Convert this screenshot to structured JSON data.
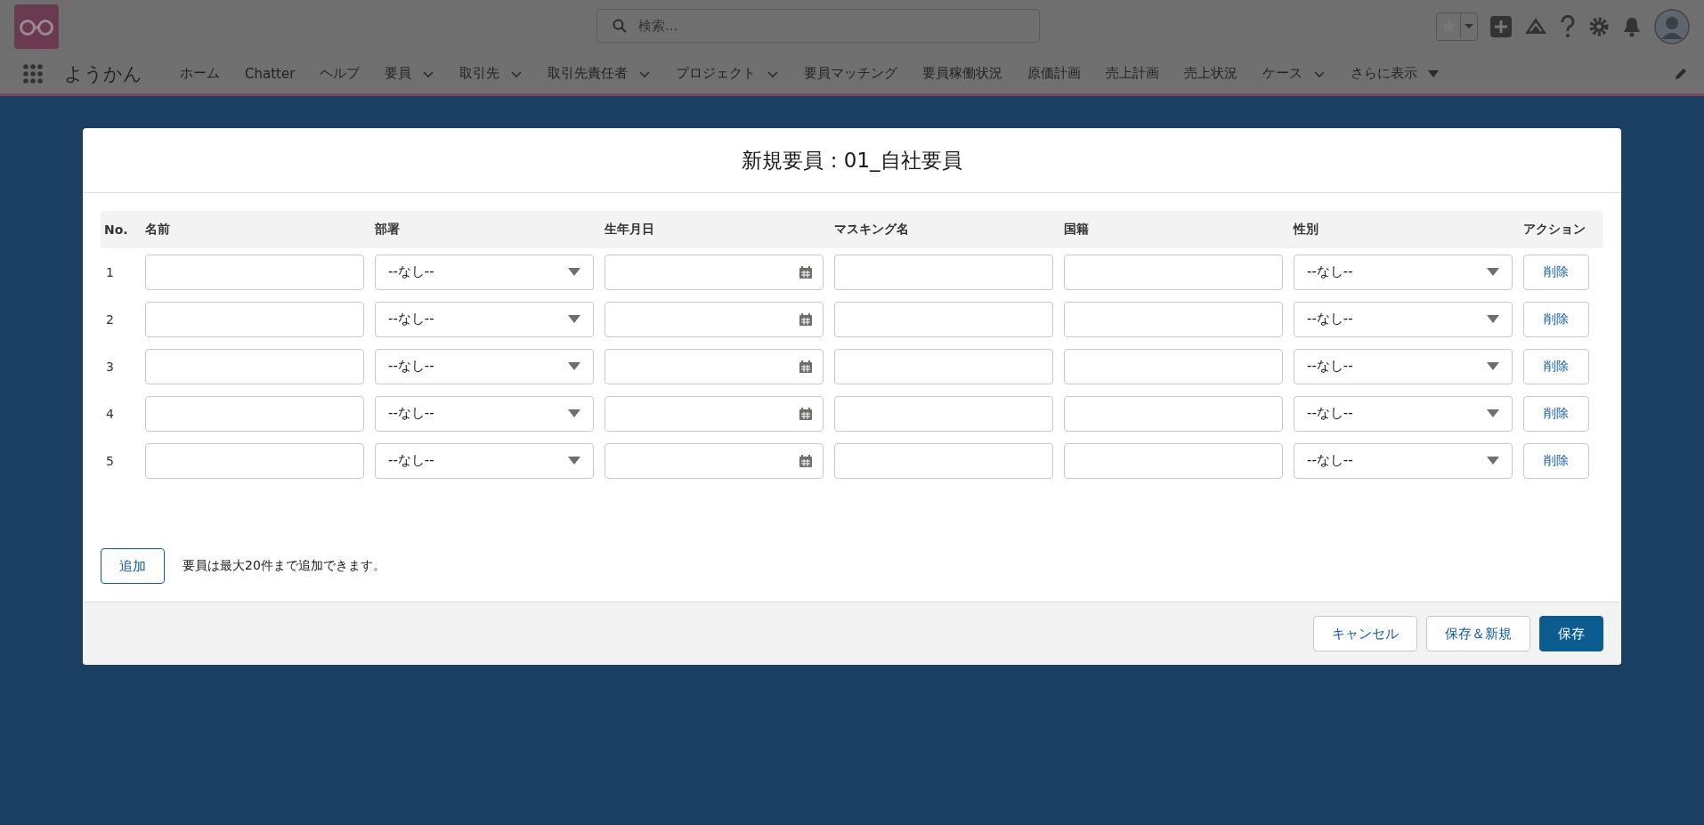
{
  "header": {
    "search": {
      "placeholder": "検索..."
    },
    "app_name": "ようかん",
    "nav_items": [
      {
        "label": "ホーム",
        "kind": "link"
      },
      {
        "label": "Chatter",
        "kind": "link"
      },
      {
        "label": "ヘルプ",
        "kind": "link"
      },
      {
        "label": "要員",
        "kind": "menu"
      },
      {
        "label": "取引先",
        "kind": "menu"
      },
      {
        "label": "取引先責任者",
        "kind": "menu"
      },
      {
        "label": "プロジェクト",
        "kind": "menu"
      },
      {
        "label": "要員マッチング",
        "kind": "link"
      },
      {
        "label": "要員稼働状況",
        "kind": "link"
      },
      {
        "label": "原価計画",
        "kind": "link"
      },
      {
        "label": "売上計画",
        "kind": "link"
      },
      {
        "label": "売上状況",
        "kind": "link"
      },
      {
        "label": "ケース",
        "kind": "menu"
      },
      {
        "label": "さらに表示",
        "kind": "more"
      }
    ]
  },
  "modal": {
    "title": "新規要員 : 01_自社要員",
    "columns": [
      "No.",
      "名前",
      "部署",
      "生年月日",
      "マスキング名",
      "国籍",
      "性別",
      "アクション"
    ],
    "rows": [
      {
        "no": "1",
        "department": "--なし--",
        "gender": "--なし--",
        "action": "削除"
      },
      {
        "no": "2",
        "department": "--なし--",
        "gender": "--なし--",
        "action": "削除"
      },
      {
        "no": "3",
        "department": "--なし--",
        "gender": "--なし--",
        "action": "削除"
      },
      {
        "no": "4",
        "department": "--なし--",
        "gender": "--なし--",
        "action": "削除"
      },
      {
        "no": "5",
        "department": "--なし--",
        "gender": "--なし--",
        "action": "削除"
      }
    ],
    "add_button": "追加",
    "note": "要員は最大20件まで追加できます。",
    "buttons": [
      {
        "label": "キャンセル",
        "kind": "neutral"
      },
      {
        "label": "保存＆新規",
        "kind": "neutral"
      },
      {
        "label": "保存",
        "kind": "brand"
      }
    ]
  }
}
